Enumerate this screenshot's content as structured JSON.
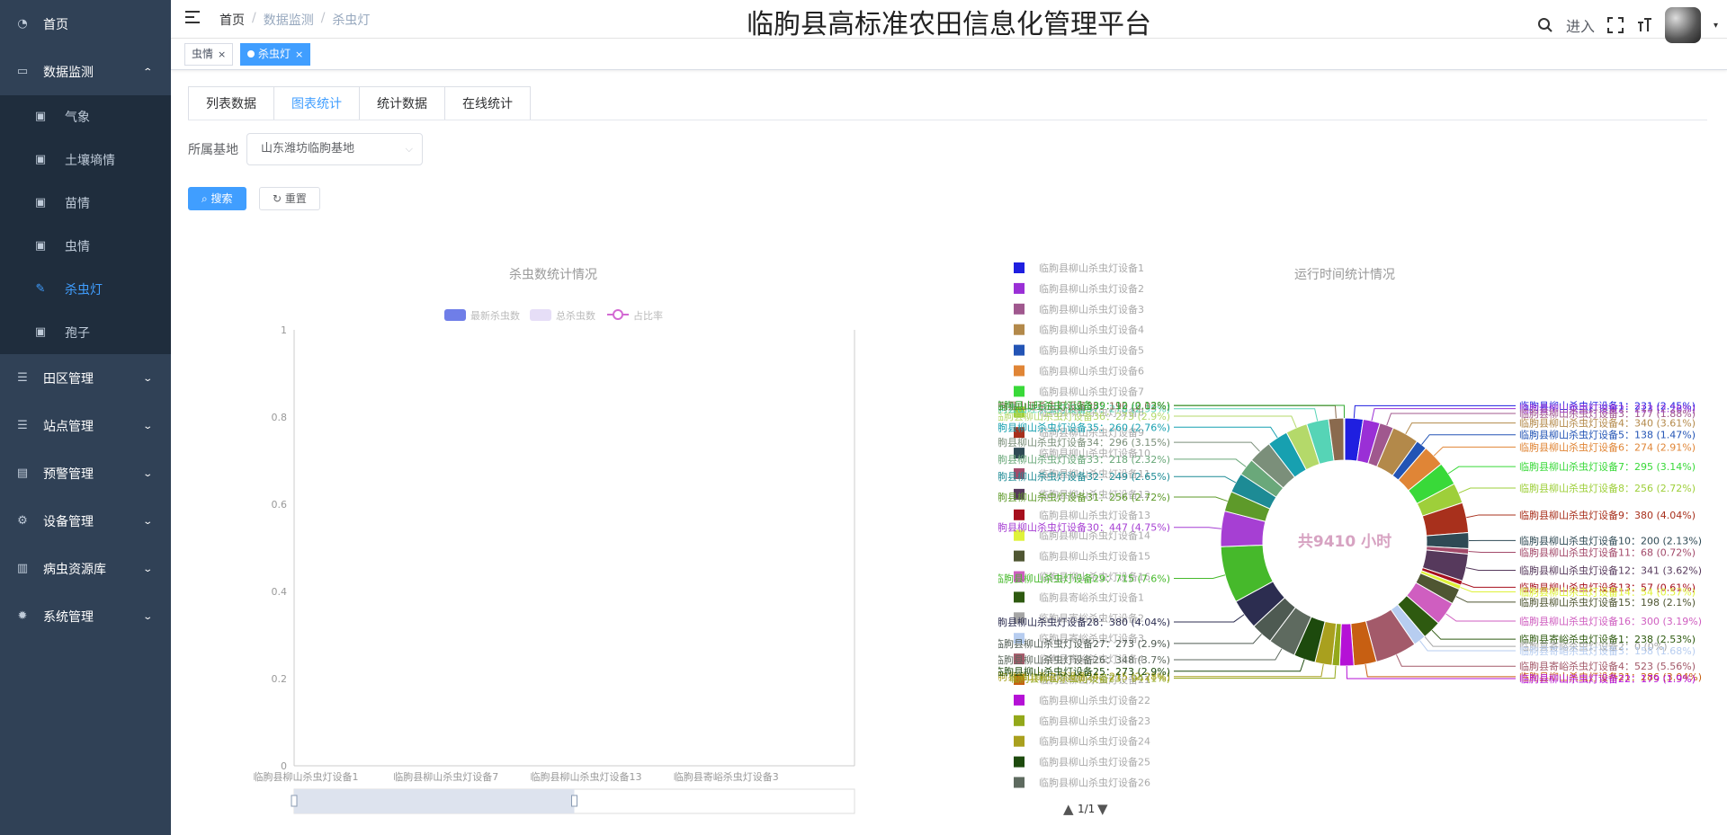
{
  "sidebar": {
    "items": [
      {
        "label": "首页",
        "icon": "dashboard-icon"
      },
      {
        "label": "数据监测",
        "icon": "monitor-icon",
        "expanded": true,
        "children": [
          {
            "label": "气象",
            "icon": "chart-icon"
          },
          {
            "label": "土壤墒情",
            "icon": "chart-icon"
          },
          {
            "label": "苗情",
            "icon": "chart-icon"
          },
          {
            "label": "虫情",
            "icon": "chart-icon"
          },
          {
            "label": "杀虫灯",
            "icon": "edit-icon",
            "active": true
          },
          {
            "label": "孢子",
            "icon": "chart-icon"
          }
        ]
      },
      {
        "label": "田区管理",
        "icon": "list-icon"
      },
      {
        "label": "站点管理",
        "icon": "list-icon"
      },
      {
        "label": "预警管理",
        "icon": "document-icon"
      },
      {
        "label": "设备管理",
        "icon": "device-icon"
      },
      {
        "label": "病虫资源库",
        "icon": "library-icon"
      },
      {
        "label": "系统管理",
        "icon": "gear-icon"
      }
    ]
  },
  "navbar": {
    "breadcrumb": [
      "首页",
      "数据监测",
      "杀虫灯"
    ],
    "title": "临朐县高标准农田信息化管理平台",
    "enter_label": "进入",
    "icons": [
      "search-icon",
      "fullscreen-icon",
      "font-size-icon"
    ]
  },
  "tags": [
    {
      "label": "虫情",
      "active": false
    },
    {
      "label": "杀虫灯",
      "active": true
    }
  ],
  "tabs": [
    "列表数据",
    "图表统计",
    "统计数据",
    "在线统计"
  ],
  "active_tab": 1,
  "form": {
    "base_label": "所属基地",
    "base_value": "山东潍坊临朐基地",
    "search_label": "搜索",
    "reset_label": "重置"
  },
  "colors": {
    "primary": "#409eff",
    "sidebar_bg": "#304156",
    "sidebar_sub_bg": "#1f2d3d"
  },
  "chart_data": [
    {
      "type": "bar",
      "title": "杀虫数统计情况",
      "legend": [
        "最新杀虫数",
        "总杀虫数",
        "占比率"
      ],
      "legend_position": "top",
      "ylim": [
        0,
        1
      ],
      "yticks": [
        "0",
        "0.2",
        "0.4",
        "0.6",
        "0.8",
        "1"
      ],
      "categories": [
        "临朐县柳山杀虫灯设备1",
        "临朐县柳山杀虫灯设备7",
        "临朐县柳山杀虫灯设备13",
        "临朐县寄峪杀虫灯设备3"
      ],
      "series": [
        {
          "name": "最新杀虫数",
          "values": [
            0,
            0,
            0,
            0
          ]
        },
        {
          "name": "总杀虫数",
          "values": [
            0,
            0,
            0,
            0
          ]
        },
        {
          "name": "占比率",
          "values": [
            0,
            0,
            0,
            0
          ]
        }
      ],
      "datazoom": {
        "start": 0,
        "end": 0.5
      }
    },
    {
      "type": "pie",
      "title": "运行时间统计情况",
      "center_label": "共9410 小时",
      "legend_page": "1/1",
      "legend": [
        "临朐县柳山杀虫灯设备1",
        "临朐县柳山杀虫灯设备2",
        "临朐县柳山杀虫灯设备3",
        "临朐县柳山杀虫灯设备4",
        "临朐县柳山杀虫灯设备5",
        "临朐县柳山杀虫灯设备6",
        "临朐县柳山杀虫灯设备7",
        "临朐县柳山杀虫灯设备8",
        "临朐县柳山杀虫灯设备9",
        "临朐县柳山杀虫灯设备10",
        "临朐县柳山杀虫灯设备11",
        "临朐县柳山杀虫灯设备12",
        "临朐县柳山杀虫灯设备13",
        "临朐县柳山杀虫灯设备14",
        "临朐县柳山杀虫灯设备15",
        "临朐县柳山杀虫灯设备16",
        "临朐县寄峪杀虫灯设备1",
        "临朐县寄峪杀虫灯设备2",
        "临朐县寄峪杀虫灯设备3",
        "临朐县寄峪杀虫灯设备4",
        "临朐县柳山杀虫灯设备21",
        "临朐县柳山杀虫灯设备22",
        "临朐县柳山杀虫灯设备23",
        "临朐县柳山杀虫灯设备24",
        "临朐县柳山杀虫灯设备25",
        "临朐县柳山杀虫灯设备26"
      ],
      "slices": [
        {
          "name": "临朐县柳山杀虫灯设备1",
          "value": 231,
          "pct": "2.45%",
          "color": "#1f1fe0"
        },
        {
          "name": "临朐县柳山杀虫灯设备2",
          "value": 213,
          "pct": "2.26%",
          "color": "#9a2fd6"
        },
        {
          "name": "临朐县柳山杀虫灯设备3",
          "value": 177,
          "pct": "1.88%",
          "color": "#a0588e"
        },
        {
          "name": "临朐县柳山杀虫灯设备4",
          "value": 340,
          "pct": "3.61%",
          "color": "#b3894a"
        },
        {
          "name": "临朐县柳山杀虫灯设备5",
          "value": 138,
          "pct": "1.47%",
          "color": "#2354b5"
        },
        {
          "name": "临朐县柳山杀虫灯设备6",
          "value": 274,
          "pct": "2.91%",
          "color": "#e08536"
        },
        {
          "name": "临朐县柳山杀虫灯设备7",
          "value": 295,
          "pct": "3.14%",
          "color": "#39d939"
        },
        {
          "name": "临朐县柳山杀虫灯设备8",
          "value": 256,
          "pct": "2.72%",
          "color": "#9ecf3a"
        },
        {
          "name": "临朐县柳山杀虫灯设备9",
          "value": 380,
          "pct": "4.04%",
          "color": "#a8301c"
        },
        {
          "name": "临朐县柳山杀虫灯设备10",
          "value": 200,
          "pct": "2.13%",
          "color": "#2f4a55"
        },
        {
          "name": "临朐县柳山杀虫灯设备11",
          "value": 68,
          "pct": "0.72%",
          "color": "#a34a6a"
        },
        {
          "name": "临朐县柳山杀虫灯设备12",
          "value": 341,
          "pct": "3.62%",
          "color": "#56395c"
        },
        {
          "name": "临朐县柳山杀虫灯设备13",
          "value": 57,
          "pct": "0.61%",
          "color": "#a60f1d"
        },
        {
          "name": "临朐县柳山杀虫灯设备14",
          "value": 54,
          "pct": "0.57%",
          "color": "#dff23a"
        },
        {
          "name": "临朐县柳山杀虫灯设备15",
          "value": 198,
          "pct": "2.1%",
          "color": "#4f5632"
        },
        {
          "name": "临朐县柳山杀虫灯设备16",
          "value": 300,
          "pct": "3.19%",
          "color": "#cf5ec0"
        },
        {
          "name": "临朐县寄峪杀虫灯设备1",
          "value": 238,
          "pct": "2.53%",
          "color": "#2e5a10"
        },
        {
          "name": "临朐县寄峪杀虫灯设备2",
          "value": 0,
          "pct": "0%",
          "color": "#a6a6a6"
        },
        {
          "name": "临朐县寄峪杀虫灯设备3",
          "value": 158,
          "pct": "1.68%",
          "color": "#b7cdf0"
        },
        {
          "name": "临朐县寄峪杀虫灯设备4",
          "value": 523,
          "pct": "5.56%",
          "color": "#a35a6a"
        },
        {
          "name": "临朐县柳山杀虫灯设备21",
          "value": 286,
          "pct": "3.04%",
          "color": "#c75f12"
        },
        {
          "name": "临朐县柳山杀虫灯设备22",
          "value": 179,
          "pct": "1.9%",
          "color": "#b511d6"
        },
        {
          "name": "临朐县柳山杀虫灯设备23",
          "value": 94,
          "pct": "1%",
          "color": "#93a81a"
        },
        {
          "name": "临朐县柳山杀虫灯设备24",
          "value": 215,
          "pct": "2.28%",
          "color": "#a9a01e"
        },
        {
          "name": "临朐县柳山杀虫灯设备25",
          "value": 273,
          "pct": "2.9%",
          "color": "#1d4a0d"
        },
        {
          "name": "临朐县柳山杀虫灯设备26",
          "value": 348,
          "pct": "3.7%",
          "color": "#5e6a5f"
        },
        {
          "name": "临朐县柳山杀虫灯设备27",
          "value": 273,
          "pct": "2.9%",
          "color": "#4e5a52"
        },
        {
          "name": "临朐县柳山杀虫灯设备28",
          "value": 380,
          "pct": "4.04%",
          "color": "#2c2d50"
        },
        {
          "name": "临朐县柳山杀虫灯设备29",
          "value": 715,
          "pct": "7.6%",
          "color": "#46b92b"
        },
        {
          "name": "临朐县柳山杀虫灯设备30",
          "value": 447,
          "pct": "4.75%",
          "color": "#a63fd3"
        },
        {
          "name": "临朐县柳山杀虫灯设备31",
          "value": 256,
          "pct": "2.72%",
          "color": "#5e9a2a"
        },
        {
          "name": "临朐县柳山杀虫灯设备32",
          "value": 249,
          "pct": "2.65%",
          "color": "#1d8b95"
        },
        {
          "name": "临朐县柳山杀虫灯设备33",
          "value": 218,
          "pct": "2.32%",
          "color": "#6aa87a"
        },
        {
          "name": "临朐县柳山杀虫灯设备34",
          "value": 296,
          "pct": "3.15%",
          "color": "#7b8f7a"
        },
        {
          "name": "临朐县柳山杀虫灯设备35",
          "value": 260,
          "pct": "2.76%",
          "color": "#17a0b0"
        },
        {
          "name": "临朐县柳山杀虫灯设备36",
          "value": 273,
          "pct": "2.9%",
          "color": "#b4d96a"
        },
        {
          "name": "临朐县山旺杀虫灯设备37",
          "value": 278,
          "pct": "2.95%",
          "color": "#56d4b6"
        },
        {
          "name": "临朐县山旺杀虫灯设备38",
          "value": 190,
          "pct": "2.02%",
          "color": "#8a6a4e"
        },
        {
          "name": "临朐县山旺杀虫灯设备39",
          "value": 12,
          "pct": "0.13%",
          "color": "#2fa82f"
        }
      ]
    }
  ]
}
